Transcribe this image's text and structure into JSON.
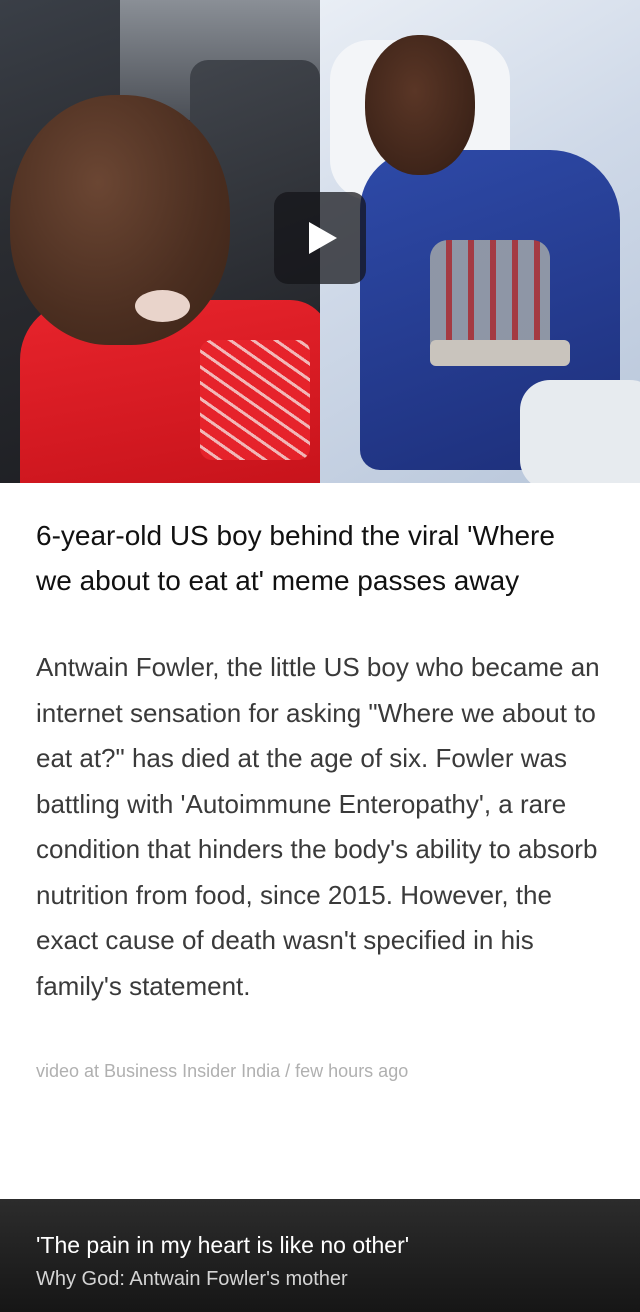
{
  "video": {
    "play_icon": "play-icon"
  },
  "article": {
    "headline": "6-year-old US boy behind the viral 'Where we about to eat at' meme passes away",
    "body": "Antwain Fowler, the little US boy who became an internet sensation for asking \"Where we about to eat at?\" has died at the age of six. Fowler was battling with 'Autoimmune Enteropathy', a rare condition that hinders the body's ability to absorb nutrition from food, since 2015. However, the exact cause of death wasn't specified in his family's statement.",
    "source": "video at Business Insider India / few hours ago"
  },
  "next_story": {
    "title": "'The pain in my heart is like no other'",
    "subtitle": "Why God: Antwain Fowler's mother"
  }
}
